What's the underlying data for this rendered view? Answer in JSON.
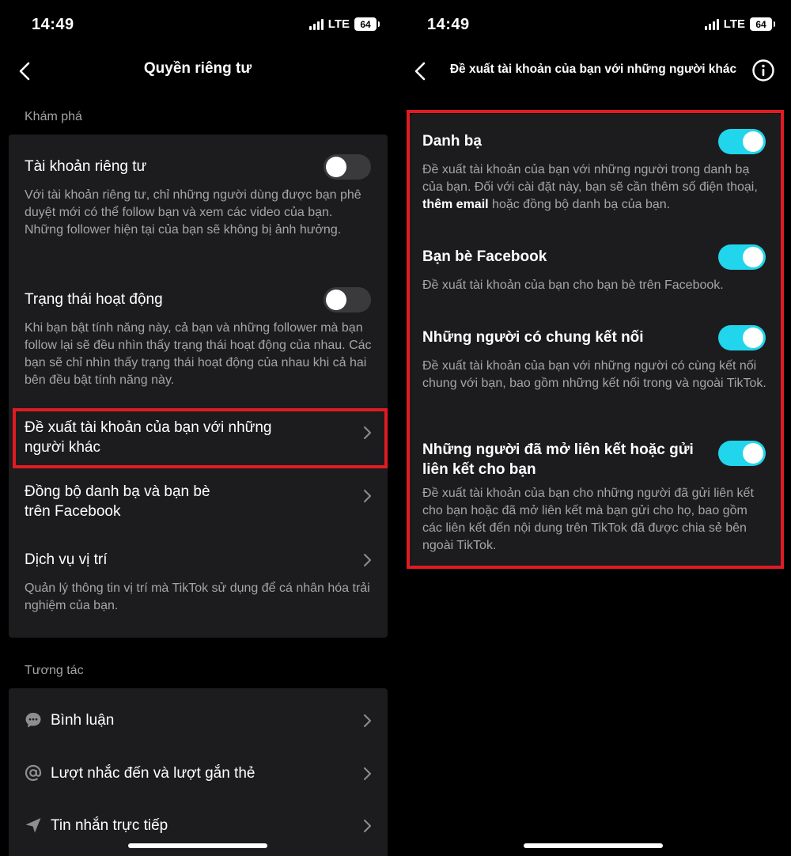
{
  "left_screen": {
    "status": {
      "time": "14:49",
      "network": "LTE",
      "battery": "64"
    },
    "title": "Quyền riêng tư",
    "section_discover": "Khám phá",
    "private_account": {
      "title": "Tài khoản riêng tư",
      "desc": "Với tài khoản riêng tư, chỉ những người dùng được bạn phê duyệt mới có thể follow bạn và xem các video của bạn. Những follower hiện tại của bạn sẽ không bị ảnh hưởng.",
      "enabled": false
    },
    "activity_status": {
      "title": "Trạng thái hoạt động",
      "desc": "Khi bạn bật tính năng này, cả bạn và những follower mà bạn follow lại sẽ đều nhìn thấy trạng thái hoạt động của nhau. Các bạn sẽ chỉ nhìn thấy trạng thái hoạt động của nhau khi cả hai bên đều bật tính năng này.",
      "enabled": false
    },
    "suggest_account": {
      "title_line1": "Đề xuất tài khoản của bạn với những",
      "title_line2": "người khác"
    },
    "sync_contacts": {
      "title_line1": "Đồng bộ danh bạ và bạn bè",
      "title_line2": "trên Facebook"
    },
    "location": {
      "title": "Dịch vụ vị trí",
      "desc": "Quản lý thông tin vị trí mà TikTok sử dụng để cá nhân hóa trải nghiệm của bạn."
    },
    "section_interaction": "Tương tác",
    "comments": "Bình luận",
    "mentions": "Lượt nhắc đến và lượt gắn thẻ",
    "direct_messages": "Tin nhắn trực tiếp"
  },
  "right_screen": {
    "status": {
      "time": "14:49",
      "network": "LTE",
      "battery": "64"
    },
    "title": "Đề xuất tài khoản của bạn với những người khác",
    "contacts": {
      "title": "Danh bạ",
      "desc_part1": "Đề xuất tài khoản của bạn với những người trong danh bạ của bạn. Đối với cài đặt này, bạn sẽ cần thêm số điện thoại, ",
      "desc_bold": "thêm email",
      "desc_part2": " hoặc đồng bộ danh bạ của bạn.",
      "enabled": true
    },
    "facebook_friends": {
      "title": "Bạn bè Facebook",
      "desc": "Đề xuất tài khoản của bạn cho bạn bè trên Facebook.",
      "enabled": true
    },
    "mutual_connections": {
      "title": "Những người có chung kết nối",
      "desc": "Đề xuất tài khoản của bạn với những người có cùng kết nối chung với bạn, bao gồm những kết nối trong và ngoài TikTok.",
      "enabled": true
    },
    "link_openers": {
      "title_line1": "Những người đã mở liên kết hoặc gửi",
      "title_line2": "liên kết cho bạn",
      "desc": "Đề xuất tài khoản của bạn cho những người đã gửi liên kết cho bạn hoặc đã mở liên kết mà bạn gửi cho họ, bao gồm các liên kết đến nội dung trên TikTok đã được chia sẻ bên ngoài TikTok.",
      "enabled": true
    }
  },
  "colors": {
    "background": "#000000",
    "card": "#1c1c1e",
    "toggle_on": "#20d5ec",
    "toggle_off": "#3a3a3c",
    "highlight": "#e01b22",
    "secondary_text": "#a5a5a5"
  }
}
